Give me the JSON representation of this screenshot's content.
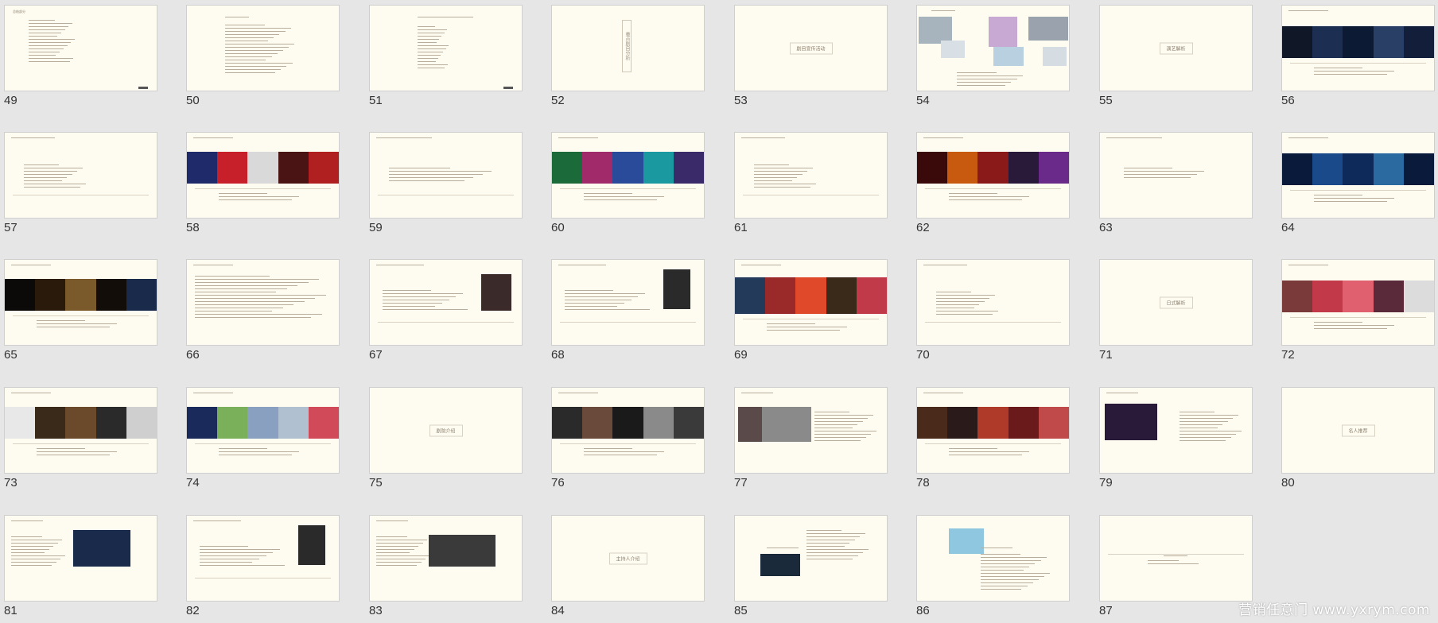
{
  "window": {
    "background": "#e6e6e6",
    "slide_background": "#fefcf1"
  },
  "slides": [
    {
      "num": "49",
      "title": "总结部分",
      "layout": "text-list"
    },
    {
      "num": "50",
      "title": "",
      "layout": "text-list2"
    },
    {
      "num": "51",
      "title": "",
      "layout": "text-list3"
    },
    {
      "num": "52",
      "title": "",
      "center": "重点剧目分析",
      "layout": "vertical"
    },
    {
      "num": "53",
      "title": "",
      "center": "剧目宣传活动",
      "layout": "center"
    },
    {
      "num": "54",
      "title": "",
      "layout": "images-scatter"
    },
    {
      "num": "55",
      "title": "",
      "center": "演艺解析",
      "layout": "center"
    },
    {
      "num": "56",
      "title": "",
      "layout": "image-strip-dark"
    },
    {
      "num": "57",
      "title": "",
      "layout": "text-list-mid"
    },
    {
      "num": "58",
      "title": "",
      "layout": "image-strip-red"
    },
    {
      "num": "59",
      "title": "",
      "layout": "text-block"
    },
    {
      "num": "60",
      "title": "",
      "layout": "image-strip-color"
    },
    {
      "num": "61",
      "title": "",
      "layout": "text-list-mid"
    },
    {
      "num": "62",
      "title": "",
      "layout": "image-strip-fire"
    },
    {
      "num": "63",
      "title": "",
      "layout": "text-short"
    },
    {
      "num": "64",
      "title": "",
      "layout": "image-strip-blue"
    },
    {
      "num": "65",
      "title": "",
      "layout": "image-strip-concert"
    },
    {
      "num": "66",
      "title": "",
      "layout": "text-dense"
    },
    {
      "num": "67",
      "title": "",
      "layout": "text-portrait"
    },
    {
      "num": "68",
      "title": "",
      "layout": "text-portrait2"
    },
    {
      "num": "69",
      "title": "",
      "layout": "image-strip-stage"
    },
    {
      "num": "70",
      "title": "",
      "layout": "text-list-mid"
    },
    {
      "num": "71",
      "title": "",
      "center": "日式解析",
      "layout": "center"
    },
    {
      "num": "72",
      "title": "",
      "layout": "image-strip-flowers"
    },
    {
      "num": "73",
      "title": "",
      "layout": "image-strip-hall"
    },
    {
      "num": "74",
      "title": "",
      "layout": "image-strip-lotus"
    },
    {
      "num": "75",
      "title": "",
      "center": "剧院介绍",
      "layout": "center"
    },
    {
      "num": "76",
      "title": "",
      "layout": "image-strip-people"
    },
    {
      "num": "77",
      "title": "",
      "layout": "image-text"
    },
    {
      "num": "78",
      "title": "",
      "layout": "image-strip-event"
    },
    {
      "num": "79",
      "title": "",
      "layout": "image-text2"
    },
    {
      "num": "80",
      "title": "",
      "center": "名人推荐",
      "layout": "center"
    },
    {
      "num": "81",
      "title": "",
      "layout": "text-image"
    },
    {
      "num": "82",
      "title": "",
      "layout": "text-portrait2"
    },
    {
      "num": "83",
      "title": "",
      "layout": "text-image2"
    },
    {
      "num": "84",
      "title": "",
      "center": "主持人介绍",
      "layout": "center"
    },
    {
      "num": "85",
      "title": "",
      "layout": "text-image3"
    },
    {
      "num": "86",
      "title": "",
      "layout": "image-text3"
    },
    {
      "num": "87",
      "title": "",
      "layout": "end"
    }
  ],
  "watermark": "营销任意门 www.yxrym.com"
}
